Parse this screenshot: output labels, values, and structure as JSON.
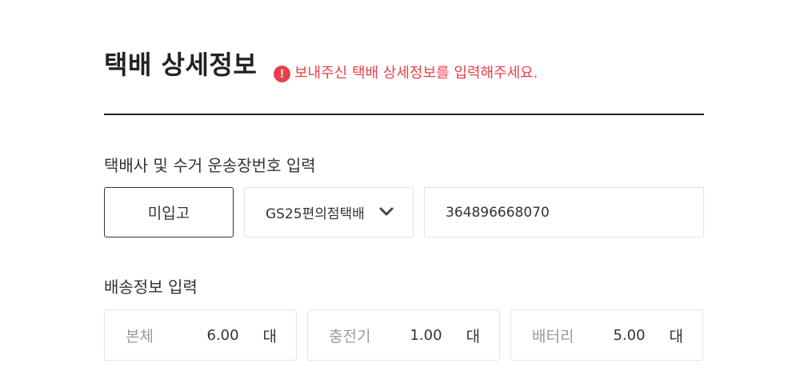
{
  "header": {
    "title": "택배 상세정보",
    "warning_icon": "exclamation-circle-icon",
    "warning_text": "보내주신 택배 상세정보를 입력해주세요.",
    "warning_color": "#e8404a"
  },
  "courier_section": {
    "label": "택배사 및 수거 운송장번호 입력",
    "not_entered_button": "미입고",
    "courier_select_value": "GS25편의점택배",
    "tracking_number": "364896668070"
  },
  "delivery_section": {
    "label": "배송정보 입력",
    "items": [
      {
        "label": "본체",
        "value": "6.00",
        "unit": "대"
      },
      {
        "label": "충전기",
        "value": "1.00",
        "unit": "대"
      },
      {
        "label": "배터리",
        "value": "5.00",
        "unit": "대"
      }
    ]
  }
}
